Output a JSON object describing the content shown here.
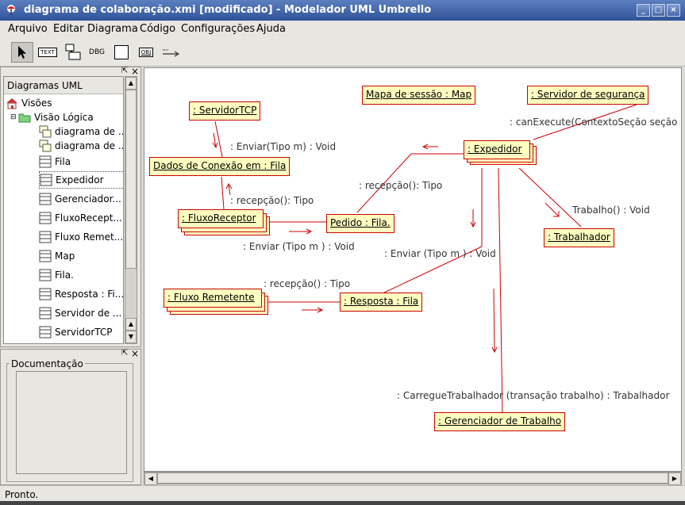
{
  "window": {
    "title": "diagrama de colaboração.xmi [modificado] - Modelador UML Umbrello",
    "buttons": [
      "_",
      "□",
      "×"
    ]
  },
  "menu": [
    "Arquivo",
    "Editar",
    "Diagrama",
    "Código",
    "Configurações",
    "Ajuda"
  ],
  "toolbar": {
    "text_tool_label": "TEXT",
    "dbg_tool_label": "DBG",
    "obj_tool_label": "OBJ"
  },
  "tree_panel": {
    "header": "Diagramas UML",
    "items": [
      {
        "label": "Visões",
        "icon": "home-icon"
      },
      {
        "label": "Visão Lógica",
        "icon": "folder-icon"
      },
      {
        "label": "diagrama de ...",
        "icon": "diagram-icon"
      },
      {
        "label": "diagrama de ...",
        "icon": "diagram-icon"
      },
      {
        "label": "Fila",
        "icon": "class-icon"
      },
      {
        "label": "Expedidor",
        "icon": "class-icon"
      },
      {
        "label": "Gerenciador...",
        "icon": "class-icon"
      },
      {
        "label": "FluxoRecept...",
        "icon": "class-icon"
      },
      {
        "label": "Fluxo Remet...",
        "icon": "class-icon"
      },
      {
        "label": "Map",
        "icon": "class-icon"
      },
      {
        "label": "Fila.",
        "icon": "class-icon"
      },
      {
        "label": "Resposta : Fi...",
        "icon": "class-icon"
      },
      {
        "label": "Servidor de ...",
        "icon": "class-icon"
      },
      {
        "label": "ServidorTCP",
        "icon": "class-icon"
      }
    ]
  },
  "doc_panel": {
    "legend": "Documentação"
  },
  "diagram": {
    "objects": {
      "servidor_tcp": ": ServidorTCP",
      "mapa_sessao": "Mapa de sessão  : Map",
      "servidor_seguranca": ": Servidor de segurança",
      "expedidor": ": Expedidor",
      "dados_conexao": "Dados de Conexão em : Fila",
      "fluxo_receptor": ": FluxoReceptor",
      "pedido": "Pedido : Fila.",
      "trabalhador": ": Trabalhador",
      "fluxo_remetente": ": Fluxo Remetente",
      "resposta": ": Resposta : Fila",
      "gerenciador": ": Gerenciador de Trabalho"
    },
    "messages": {
      "can_execute": ": canExecute(ContextoSeção seção",
      "enviar_1": ": Enviar(Tipo m) : Void",
      "recepcao_1": ": recepção(): Tipo",
      "recepcao_2": ": recepção(): Tipo",
      "enviar_2": ": Enviar (Tipo m ) : Void",
      "enviar_3": ": Enviar (Tipo m ) : Void",
      "trabalho": "Trabalho() : Void",
      "recepcao_3": ": recepção() : Tipo",
      "carregue": ": CarregueTrabalhador (transação trabalho) : Trabalhador"
    }
  },
  "status": "Pronto."
}
